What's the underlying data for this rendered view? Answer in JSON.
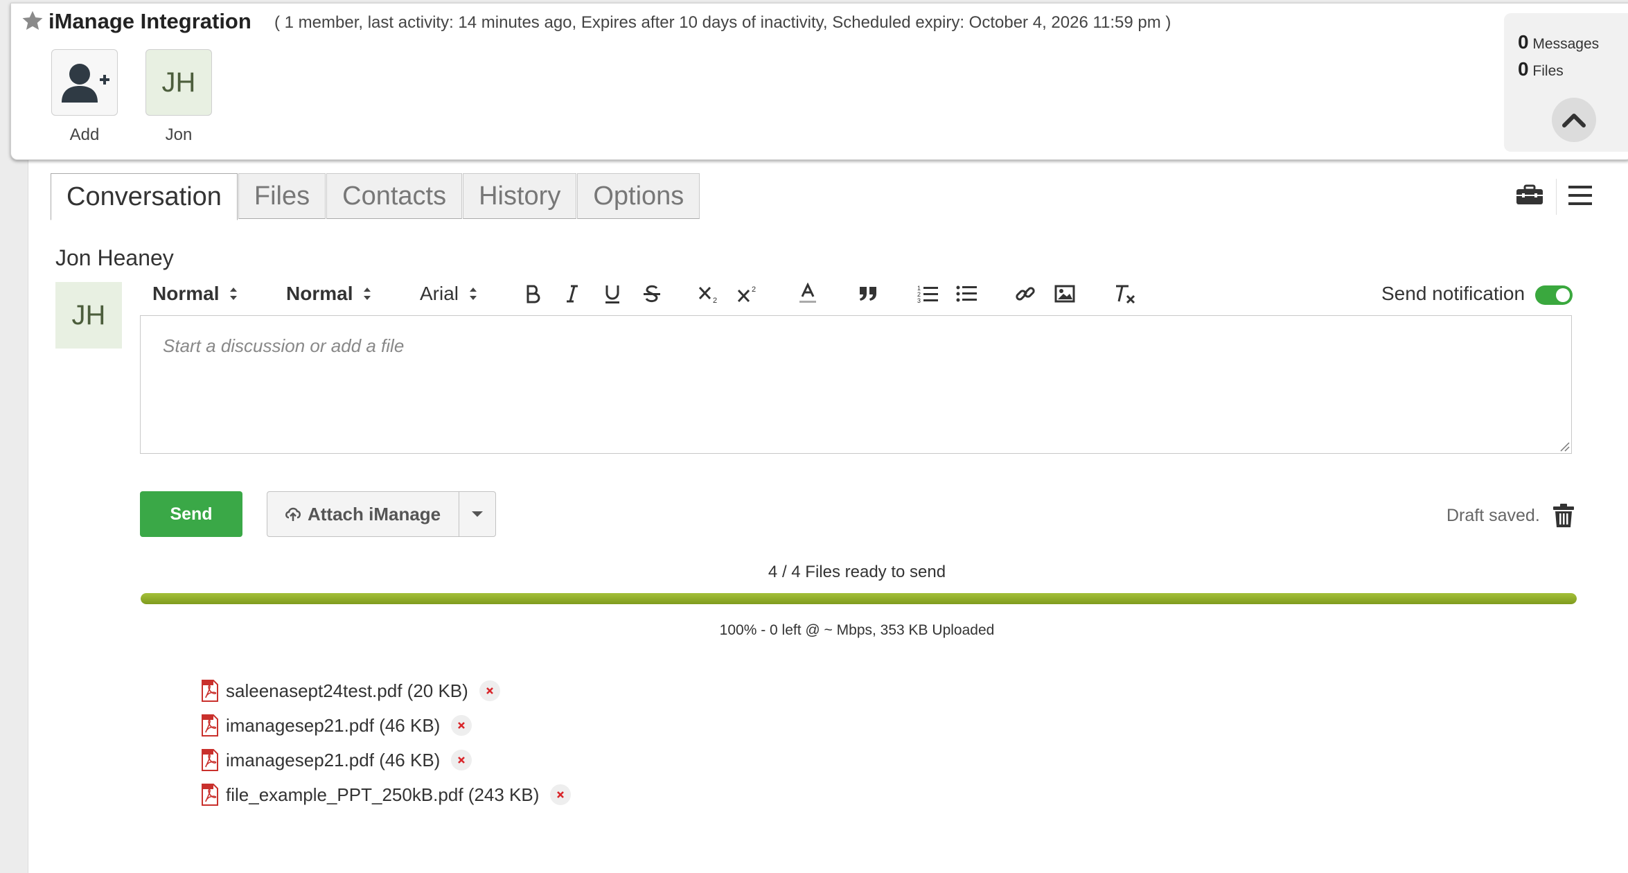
{
  "room": {
    "title": "iManage Integration",
    "meta": "( 1 member, last activity: 14 minutes ago, Expires after 10 days of inactivity, Scheduled expiry: October 4, 2026 11:59 pm )"
  },
  "members": {
    "add_label": "Add",
    "jon_initials": "JH",
    "jon_label": "Jon"
  },
  "stats": {
    "messages_count": "0",
    "messages_label": "Messages",
    "files_count": "0",
    "files_label": "Files"
  },
  "tabs": [
    {
      "label": "Conversation",
      "active": true
    },
    {
      "label": "Files"
    },
    {
      "label": "Contacts"
    },
    {
      "label": "History"
    },
    {
      "label": "Options"
    }
  ],
  "composer": {
    "sender_name": "Jon Heaney",
    "sender_initials": "JH",
    "block_format": "Normal",
    "size_format": "Normal",
    "font": "Arial",
    "notify_label": "Send notification",
    "notify_on": true,
    "placeholder": "Start a discussion or add a file",
    "send_label": "Send",
    "attach_label": "Attach iManage",
    "draft_status": "Draft saved."
  },
  "upload": {
    "status": "4 / 4 Files ready to send",
    "progress": 1.0,
    "detail": "100% - 0 left @ ~ Mbps, 353 KB Uploaded"
  },
  "files": [
    {
      "name": "saleenasept24test.pdf",
      "size": "(20 KB)"
    },
    {
      "name": "imanagesep21.pdf",
      "size": "(46 KB)"
    },
    {
      "name": "imanagesep21.pdf",
      "size": "(46 KB)"
    },
    {
      "name": "file_example_PPT_250kB.pdf",
      "size": "(243 KB)"
    }
  ],
  "colors": {
    "accent_green": "#3aa847",
    "progress_green": "#8aa82a",
    "remove_red": "#d9262b",
    "pdf_red": "#c9302c"
  }
}
